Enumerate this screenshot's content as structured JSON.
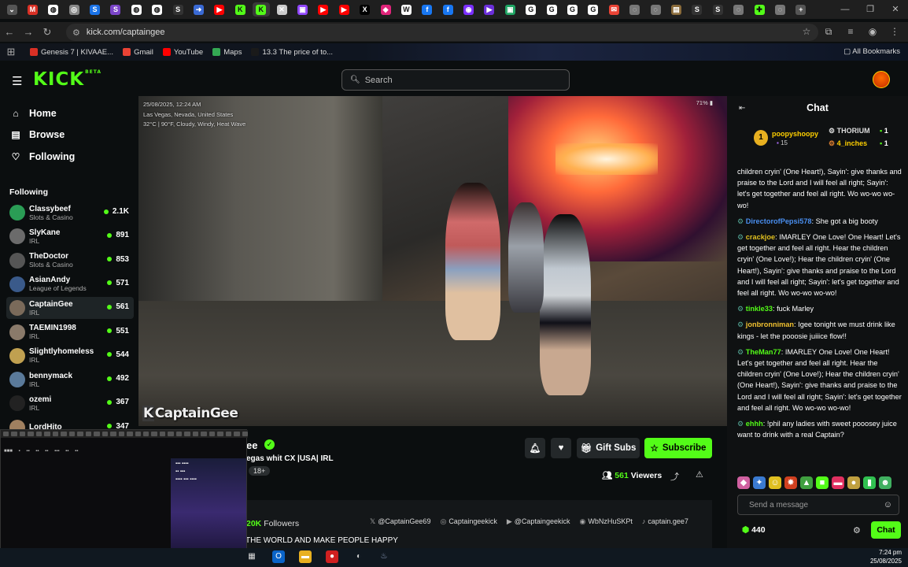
{
  "browser": {
    "tabs": [
      {
        "icon": "chevron-down-icon",
        "color": "#555"
      },
      {
        "icon": "gmail-icon",
        "color": "#d93025"
      },
      {
        "icon": "page-icon",
        "color": "#ffffff"
      },
      {
        "icon": "spiral-icon",
        "color": "#888"
      },
      {
        "icon": "s-icon",
        "color": "#1a73e8"
      },
      {
        "icon": "s-icon",
        "color": "#7b45c9"
      },
      {
        "icon": "page-icon",
        "color": "#ffffff"
      },
      {
        "icon": "page-icon",
        "color": "#ffffff"
      },
      {
        "icon": "s-icon",
        "color": "#333"
      },
      {
        "icon": "arrow-icon",
        "color": "#3a6ad4"
      },
      {
        "icon": "youtube-icon",
        "color": "#ff0000"
      },
      {
        "icon": "kick-icon",
        "color": "#53fc18"
      },
      {
        "icon": "kick-icon",
        "color": "#53fc18",
        "active": true
      },
      {
        "icon": "close-icon",
        "color": "#ccc"
      },
      {
        "icon": "twitch-icon",
        "color": "#9146ff"
      },
      {
        "icon": "youtube-icon",
        "color": "#ff0000"
      },
      {
        "icon": "youtube-icon",
        "color": "#ff0000"
      },
      {
        "icon": "x-icon",
        "color": "#000"
      },
      {
        "icon": "game-icon",
        "color": "#e0247a"
      },
      {
        "icon": "w-icon",
        "color": "#fff"
      },
      {
        "icon": "facebook-icon",
        "color": "#1877f2"
      },
      {
        "icon": "facebook-icon",
        "color": "#1877f2"
      },
      {
        "icon": "purple-icon",
        "color": "#7b2fff"
      },
      {
        "icon": "play-icon",
        "color": "#6b2fd9"
      },
      {
        "icon": "green-icon",
        "color": "#1fa463"
      },
      {
        "icon": "google-icon",
        "color": "#ffffff"
      },
      {
        "icon": "google-icon",
        "color": "#ffffff"
      },
      {
        "icon": "google-icon",
        "color": "#ffffff"
      },
      {
        "icon": "google-icon",
        "color": "#ffffff"
      },
      {
        "icon": "mail-icon",
        "color": "#ea4335"
      },
      {
        "icon": "globe-icon",
        "color": "#777"
      },
      {
        "icon": "globe-icon",
        "color": "#777"
      },
      {
        "icon": "book-icon",
        "color": "#8a6b3a"
      },
      {
        "icon": "s-icon",
        "color": "#333"
      },
      {
        "icon": "s-icon",
        "color": "#333"
      },
      {
        "icon": "globe-icon",
        "color": "#777"
      },
      {
        "icon": "puzzle-icon",
        "color": "#53fc18"
      },
      {
        "icon": "globe-icon",
        "color": "#777"
      },
      {
        "icon": "plus-icon",
        "color": "#555"
      }
    ],
    "url": "kick.com/captaingee",
    "bookmarks": [
      {
        "label": "Genesis 7 | KIVAAE...",
        "color": "#d93025"
      },
      {
        "label": "Gmail",
        "color": "#ea4335"
      },
      {
        "label": "YouTube",
        "color": "#ff0000"
      },
      {
        "label": "Maps",
        "color": "#34a853"
      },
      {
        "label": "13.3 The price of to...",
        "color": "#1a1a1a"
      }
    ],
    "all_bookmarks": "All Bookmarks"
  },
  "header": {
    "logo": "KICK",
    "logo_sup": "BETA",
    "search_placeholder": "Search"
  },
  "sidebar": {
    "nav": [
      {
        "label": "Home",
        "icon": "home-icon",
        "glyph": "⌂"
      },
      {
        "label": "Browse",
        "icon": "browse-icon",
        "glyph": "▤"
      },
      {
        "label": "Following",
        "icon": "heart-icon",
        "glyph": "♡"
      }
    ],
    "following_title": "Following",
    "channels": [
      {
        "name": "Classybeef",
        "category": "Slots & Casino",
        "viewers": "2.1K",
        "color": "#2a9d55"
      },
      {
        "name": "SlyKane",
        "category": "IRL",
        "viewers": "891",
        "color": "#6b6b6b"
      },
      {
        "name": "TheDoctor",
        "category": "Slots & Casino",
        "viewers": "853",
        "color": "#555"
      },
      {
        "name": "AsianAndy",
        "category": "League of Legends",
        "viewers": "571",
        "color": "#3a5a8a"
      },
      {
        "name": "CaptainGee",
        "category": "IRL",
        "viewers": "561",
        "color": "#7a6a5a",
        "selected": true
      },
      {
        "name": "TAEMIN1998",
        "category": "IRL",
        "viewers": "551",
        "color": "#8a7a6a"
      },
      {
        "name": "Slightlyhomeless",
        "category": "IRL",
        "viewers": "544",
        "color": "#c0a050"
      },
      {
        "name": "bennymack",
        "category": "IRL",
        "viewers": "492",
        "color": "#5a7a9a"
      },
      {
        "name": "ozemi",
        "category": "IRL",
        "viewers": "367",
        "color": "#222"
      },
      {
        "name": "LordHito",
        "category": "",
        "viewers": "347",
        "color": "#a08060"
      }
    ]
  },
  "video": {
    "info_lines": [
      "25/08/2025, 12:24 AM",
      "Las Vegas, Nevada, United States",
      "32°C | 90°F, Cloudy, Windy, Heat Wave"
    ],
    "battery": "71%",
    "watermark": "CaptainGee"
  },
  "stream": {
    "title_partial": "ee",
    "subtitle_partial": "egas whit CX  |USA| IRL",
    "rating": "18+",
    "gift_subs": "Gift Subs",
    "subscribe": "Subscribe",
    "viewers_count": "561",
    "viewers_label": "Viewers",
    "followers_count": "20K",
    "followers_label": "Followers",
    "socials": [
      {
        "icon": "x-icon",
        "glyph": "𝕏",
        "label": "@CaptainGee69"
      },
      {
        "icon": "instagram-icon",
        "glyph": "◎",
        "label": "Captaingeekick"
      },
      {
        "icon": "youtube-icon",
        "glyph": "▶",
        "label": "@Captaingeekick"
      },
      {
        "icon": "discord-icon",
        "glyph": "◉",
        "label": "WbNzHuSKPt"
      },
      {
        "icon": "tiktok-icon",
        "glyph": "♪",
        "label": "captain.gee7"
      }
    ],
    "about": "THE WORLD AND MAKE PEOPLE HAPPY"
  },
  "chat": {
    "title": "Chat",
    "gifters": {
      "top_badge": "1",
      "top_name": "poopyshoopy",
      "top_count": "15",
      "second_name": "THORIUM",
      "second_count": "1",
      "third_name": "4_inches",
      "third_count": "1"
    },
    "messages": [
      {
        "user": "",
        "text": "children cryin' (One Heart!), Sayin': give thanks and praise to the Lord and I will feel all right; Sayin': let's get together and feel all right. Wo wo-wo wo-wo!",
        "color": "#fff"
      },
      {
        "user": "DirectorofPepsi578",
        "text": "She got a big booty",
        "color": "#4a8ff0"
      },
      {
        "user": "crackjoe",
        "text": "IMARLEY One Love! One Heart! Let's get together and feel all right. Hear the children cryin' (One Love!); Hear the children cryin' (One Heart!), Sayin': give thanks and praise to the Lord and I will feel all right; Sayin': let's get together and feel all right. Wo wo-wo wo-wo!",
        "color": "#e0c020"
      },
      {
        "user": "tinkle33",
        "text": "fuck Marley",
        "color": "#53fc18"
      },
      {
        "user": "jonbronniman",
        "text": "Igee tonight we must drink like kings - let the pooosie juiiice flow!!",
        "color": "#f0c030"
      },
      {
        "user": "TheMan77",
        "text": "IMARLEY One Love! One Heart! Let's get together and feel all right. Hear the children cryin' (One Love!); Hear the children cryin' (One Heart!), Sayin': give thanks and praise to the Lord and I will feel all right; Sayin': let's get together and feel all right. Wo wo-wo wo-wo!",
        "color": "#53fc18"
      },
      {
        "user": "ehhh",
        "text": "!phil any ladies with sweet pooosey juice want to drink with a real Captain?",
        "color": "#53fc18"
      }
    ],
    "input_placeholder": "Send a message",
    "points": "440",
    "chat_button": "Chat"
  },
  "taskbar": {
    "time": "7:24 pm",
    "date": "25/08/2025"
  }
}
